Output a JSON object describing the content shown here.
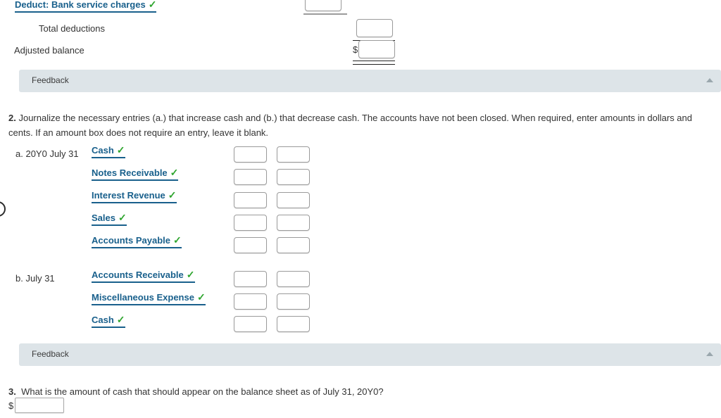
{
  "bank_reconciliation": {
    "deduct_row": {
      "label": "Deduct: Bank service charges",
      "check": "✓"
    },
    "total_deductions_label": "Total deductions",
    "adjusted_balance_label": "Adjusted balance",
    "currency_symbol": "$"
  },
  "feedback_top": {
    "label": "Feedback",
    "toggle_icon": "collapse-triangle-up"
  },
  "question2": {
    "number": "2.",
    "text": "Journalize the necessary entries (a.) that increase cash and (b.) that decrease cash. The accounts have not been closed. When required, enter amounts in dollars and cents. If an amount box does not require an entry, leave it blank.",
    "entries": [
      {
        "ref": "a.",
        "date": "20Y0 July 31",
        "lines": [
          {
            "account": "Cash",
            "check": "✓",
            "debit": "",
            "credit": ""
          },
          {
            "account": "Notes Receivable",
            "check": "✓",
            "debit": "",
            "credit": ""
          },
          {
            "account": "Interest Revenue",
            "check": "✓",
            "debit": "",
            "credit": ""
          },
          {
            "account": "Sales",
            "check": "✓",
            "debit": "",
            "credit": ""
          },
          {
            "account": "Accounts Payable",
            "check": "✓",
            "debit": "",
            "credit": ""
          }
        ]
      },
      {
        "ref": "b.",
        "date": "July 31",
        "lines": [
          {
            "account": "Accounts Receivable",
            "check": "✓",
            "debit": "",
            "credit": ""
          },
          {
            "account": "Miscellaneous Expense",
            "check": "✓",
            "debit": "",
            "credit": ""
          },
          {
            "account": "Cash",
            "check": "✓",
            "debit": "",
            "credit": ""
          }
        ]
      }
    ]
  },
  "feedback_bottom": {
    "label": "Feedback",
    "toggle_icon": "collapse-triangle-up"
  },
  "question3": {
    "number": "3.",
    "text": "What is the amount of cash that should appear on the balance sheet as of July 31, 20Y0?",
    "currency_symbol": "$",
    "answer": ""
  },
  "colors": {
    "account_link": "#19608c",
    "checkmark_green": "#2ea52e",
    "feedback_bg": "#dde4e8",
    "body_text": "#333333",
    "input_border": "#9b9b9b"
  }
}
